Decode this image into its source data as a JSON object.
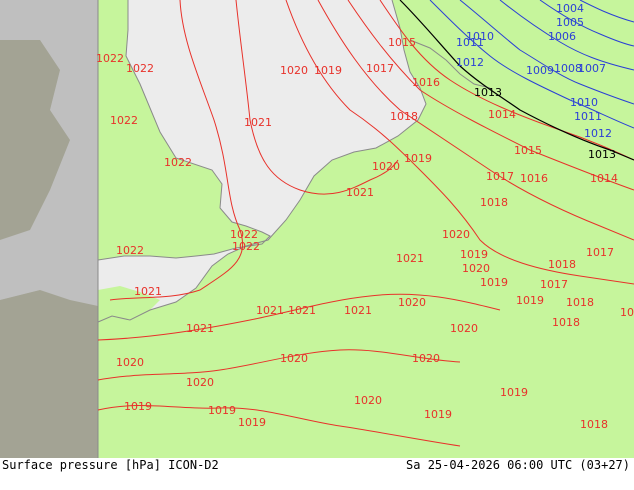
{
  "map": {
    "colors": {
      "out_of_domain": "#bfbfbf",
      "land_in_domain": "#c6f59c",
      "sea_in_domain": "#ececec",
      "coast": "#8a8a8a",
      "isobar_red": "#e8312a",
      "isobar_blue": "#2a3fd6",
      "isobar_black": "#000000"
    },
    "isobar_labels": [
      {
        "text": "1022",
        "color": "red"
      },
      {
        "text": "1022",
        "color": "red"
      },
      {
        "text": "1022",
        "color": "red"
      },
      {
        "text": "1022",
        "color": "red"
      },
      {
        "text": "1022",
        "color": "red"
      },
      {
        "text": "1022",
        "color": "red"
      },
      {
        "text": "1022",
        "color": "red"
      },
      {
        "text": "1021",
        "color": "red"
      },
      {
        "text": "1021",
        "color": "red"
      },
      {
        "text": "1021",
        "color": "red"
      },
      {
        "text": "1021",
        "color": "red"
      },
      {
        "text": "1021",
        "color": "red"
      },
      {
        "text": "1021",
        "color": "red"
      },
      {
        "text": "1021",
        "color": "red"
      },
      {
        "text": "1021",
        "color": "red"
      },
      {
        "text": "1020",
        "color": "red"
      },
      {
        "text": "1020",
        "color": "red"
      },
      {
        "text": "1020",
        "color": "red"
      },
      {
        "text": "1020",
        "color": "red"
      },
      {
        "text": "1020",
        "color": "red"
      },
      {
        "text": "1020",
        "color": "red"
      },
      {
        "text": "1020",
        "color": "red"
      },
      {
        "text": "1020",
        "color": "red"
      },
      {
        "text": "1020",
        "color": "red"
      },
      {
        "text": "1020",
        "color": "red"
      },
      {
        "text": "1020",
        "color": "red"
      },
      {
        "text": "1019",
        "color": "red"
      },
      {
        "text": "1019",
        "color": "red"
      },
      {
        "text": "1019",
        "color": "red"
      },
      {
        "text": "1019",
        "color": "red"
      },
      {
        "text": "1019",
        "color": "red"
      },
      {
        "text": "1019",
        "color": "red"
      },
      {
        "text": "1019",
        "color": "red"
      },
      {
        "text": "1019",
        "color": "red"
      },
      {
        "text": "1019",
        "color": "red"
      },
      {
        "text": "1019",
        "color": "red"
      },
      {
        "text": "1018",
        "color": "red"
      },
      {
        "text": "1018",
        "color": "red"
      },
      {
        "text": "1018",
        "color": "red"
      },
      {
        "text": "1018",
        "color": "red"
      },
      {
        "text": "1018",
        "color": "red"
      },
      {
        "text": "1018",
        "color": "red"
      },
      {
        "text": "1018",
        "color": "red"
      },
      {
        "text": "1017",
        "color": "red"
      },
      {
        "text": "1017",
        "color": "red"
      },
      {
        "text": "1017",
        "color": "red"
      },
      {
        "text": "1017",
        "color": "red"
      },
      {
        "text": "1016",
        "color": "red"
      },
      {
        "text": "1016",
        "color": "red"
      },
      {
        "text": "1015",
        "color": "red"
      },
      {
        "text": "1015",
        "color": "red"
      },
      {
        "text": "1014",
        "color": "red"
      },
      {
        "text": "1014",
        "color": "red"
      },
      {
        "text": "1013",
        "color": "black"
      },
      {
        "text": "1013",
        "color": "black"
      },
      {
        "text": "1012",
        "color": "blue"
      },
      {
        "text": "1012",
        "color": "blue"
      },
      {
        "text": "1011",
        "color": "blue"
      },
      {
        "text": "1011",
        "color": "blue"
      },
      {
        "text": "1010",
        "color": "blue"
      },
      {
        "text": "1010",
        "color": "blue"
      },
      {
        "text": "1009",
        "color": "blue"
      },
      {
        "text": "1008",
        "color": "blue"
      },
      {
        "text": "1007",
        "color": "blue"
      },
      {
        "text": "1006",
        "color": "blue"
      },
      {
        "text": "1005",
        "color": "blue"
      },
      {
        "text": "1004",
        "color": "blue"
      }
    ]
  },
  "footer": {
    "left_text": "Surface pressure [hPa] ICON-D2",
    "right_text": "Sa 25-04-2026 06:00 UTC (03+27)"
  }
}
